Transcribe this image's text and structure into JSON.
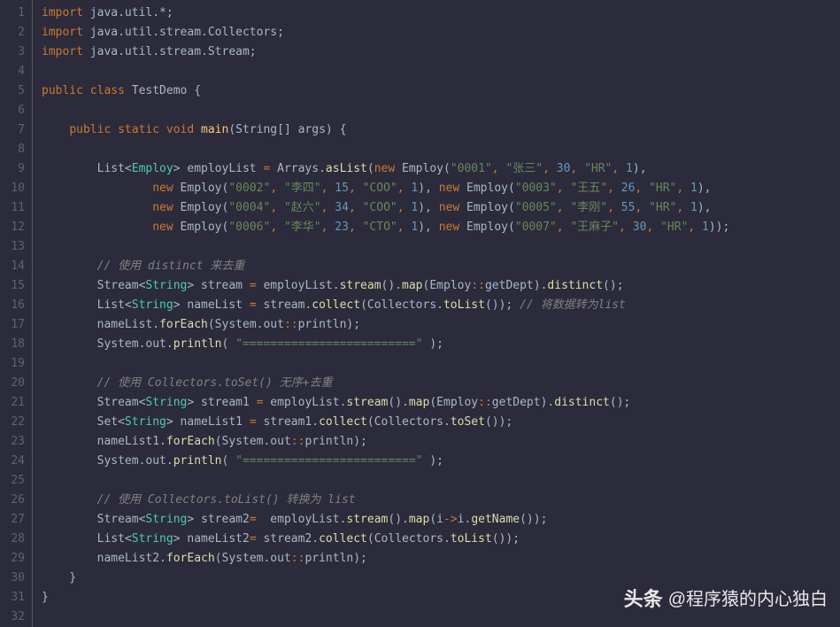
{
  "lines": [
    {
      "n": 1,
      "seg": [
        [
          "kw",
          "import"
        ],
        [
          "",
          ""
        ],
        [
          "punc",
          " java.util.*;"
        ]
      ]
    },
    {
      "n": 2,
      "seg": [
        [
          "kw",
          "import"
        ],
        [
          "punc",
          " java.util.stream.Collectors;"
        ]
      ]
    },
    {
      "n": 3,
      "seg": [
        [
          "kw",
          "import"
        ],
        [
          "punc",
          " java.util.stream.Stream;"
        ]
      ]
    },
    {
      "n": 4,
      "seg": [
        [
          "",
          ""
        ]
      ]
    },
    {
      "n": 5,
      "seg": [
        [
          "kw",
          "public class"
        ],
        [
          "punc",
          " TestDemo {"
        ]
      ]
    },
    {
      "n": 6,
      "seg": [
        [
          "",
          ""
        ]
      ]
    },
    {
      "n": 7,
      "seg": [
        [
          "",
          "    "
        ],
        [
          "kw",
          "public static void "
        ],
        [
          "fn",
          "main"
        ],
        [
          "punc",
          "(String[] args"
        ],
        [
          "paren",
          ")"
        ],
        [
          "punc",
          " {"
        ]
      ]
    },
    {
      "n": 8,
      "seg": [
        [
          "",
          ""
        ]
      ]
    },
    {
      "n": 9,
      "seg": [
        [
          "",
          "        List<"
        ],
        [
          "type",
          "Employ"
        ],
        [
          "punc",
          "> employList "
        ],
        [
          "op",
          "="
        ],
        [
          "punc",
          " Arrays."
        ],
        [
          "fn2",
          "asList"
        ],
        [
          "punc",
          "("
        ],
        [
          "kw",
          "new"
        ],
        [
          "punc",
          " Employ("
        ],
        [
          "str",
          "\"0001\""
        ],
        [
          "op",
          ", "
        ],
        [
          "str",
          "\"张三\""
        ],
        [
          "op",
          ", "
        ],
        [
          "num",
          "30"
        ],
        [
          "op",
          ", "
        ],
        [
          "str",
          "\"HR\""
        ],
        [
          "op",
          ", "
        ],
        [
          "num",
          "1"
        ],
        [
          "punc",
          "),"
        ]
      ]
    },
    {
      "n": 10,
      "seg": [
        [
          "",
          "                "
        ],
        [
          "kw",
          "new"
        ],
        [
          "punc",
          " Employ("
        ],
        [
          "str",
          "\"0002\""
        ],
        [
          "op",
          ", "
        ],
        [
          "str",
          "\"李四\""
        ],
        [
          "op",
          ", "
        ],
        [
          "num",
          "15"
        ],
        [
          "op",
          ", "
        ],
        [
          "str",
          "\"COO\""
        ],
        [
          "op",
          ", "
        ],
        [
          "num",
          "1"
        ],
        [
          "punc",
          "), "
        ],
        [
          "kw",
          "new"
        ],
        [
          "punc",
          " Employ("
        ],
        [
          "str",
          "\"0003\""
        ],
        [
          "op",
          ", "
        ],
        [
          "str",
          "\"王五\""
        ],
        [
          "op",
          ", "
        ],
        [
          "num",
          "26"
        ],
        [
          "op",
          ", "
        ],
        [
          "str",
          "\"HR\""
        ],
        [
          "op",
          ", "
        ],
        [
          "num",
          "1"
        ],
        [
          "punc",
          "),"
        ]
      ]
    },
    {
      "n": 11,
      "seg": [
        [
          "",
          "                "
        ],
        [
          "kw",
          "new"
        ],
        [
          "punc",
          " Employ("
        ],
        [
          "str",
          "\"0004\""
        ],
        [
          "op",
          ", "
        ],
        [
          "str",
          "\"赵六\""
        ],
        [
          "op",
          ", "
        ],
        [
          "num",
          "34"
        ],
        [
          "op",
          ", "
        ],
        [
          "str",
          "\"COO\""
        ],
        [
          "op",
          ", "
        ],
        [
          "num",
          "1"
        ],
        [
          "punc",
          "), "
        ],
        [
          "kw",
          "new"
        ],
        [
          "punc",
          " Employ("
        ],
        [
          "str",
          "\"0005\""
        ],
        [
          "op",
          ", "
        ],
        [
          "str",
          "\"李刚\""
        ],
        [
          "op",
          ", "
        ],
        [
          "num",
          "55"
        ],
        [
          "op",
          ", "
        ],
        [
          "str",
          "\"HR\""
        ],
        [
          "op",
          ", "
        ],
        [
          "num",
          "1"
        ],
        [
          "punc",
          "),"
        ]
      ]
    },
    {
      "n": 12,
      "seg": [
        [
          "",
          "                "
        ],
        [
          "kw",
          "new"
        ],
        [
          "punc",
          " Employ("
        ],
        [
          "str",
          "\"0006\""
        ],
        [
          "op",
          ", "
        ],
        [
          "str",
          "\"李华\""
        ],
        [
          "op",
          ", "
        ],
        [
          "num",
          "23"
        ],
        [
          "op",
          ", "
        ],
        [
          "str",
          "\"CTO\""
        ],
        [
          "op",
          ", "
        ],
        [
          "num",
          "1"
        ],
        [
          "punc",
          "), "
        ],
        [
          "kw",
          "new"
        ],
        [
          "punc",
          " Employ("
        ],
        [
          "str",
          "\"0007\""
        ],
        [
          "op",
          ", "
        ],
        [
          "str",
          "\"王麻子\""
        ],
        [
          "op",
          ", "
        ],
        [
          "num",
          "30"
        ],
        [
          "op",
          ", "
        ],
        [
          "str",
          "\"HR\""
        ],
        [
          "op",
          ", "
        ],
        [
          "num",
          "1"
        ],
        [
          "punc",
          "));"
        ]
      ]
    },
    {
      "n": 13,
      "seg": [
        [
          "",
          ""
        ]
      ]
    },
    {
      "n": 14,
      "seg": [
        [
          "",
          "        "
        ],
        [
          "cmt",
          "// 使用 distinct 来去重"
        ]
      ]
    },
    {
      "n": 15,
      "seg": [
        [
          "",
          "        Stream<"
        ],
        [
          "type",
          "String"
        ],
        [
          "punc",
          "> stream "
        ],
        [
          "op",
          "="
        ],
        [
          "punc",
          " employList."
        ],
        [
          "fn2",
          "stream"
        ],
        [
          "punc",
          "()."
        ],
        [
          "fn2",
          "map"
        ],
        [
          "punc",
          "(Employ"
        ],
        [
          "op",
          "::"
        ],
        [
          "punc",
          "getDept)."
        ],
        [
          "fn2",
          "distinct"
        ],
        [
          "punc",
          "();"
        ]
      ]
    },
    {
      "n": 16,
      "seg": [
        [
          "",
          "        List<"
        ],
        [
          "type",
          "String"
        ],
        [
          "punc",
          "> nameList "
        ],
        [
          "op",
          "="
        ],
        [
          "punc",
          " stream."
        ],
        [
          "fn2",
          "collect"
        ],
        [
          "punc",
          "(Collectors."
        ],
        [
          "fn2",
          "toList"
        ],
        [
          "punc",
          "()); "
        ],
        [
          "cmt",
          "// 将数据转为list"
        ]
      ]
    },
    {
      "n": 17,
      "seg": [
        [
          "",
          "        nameList."
        ],
        [
          "fn2",
          "forEach"
        ],
        [
          "punc",
          "(System.out"
        ],
        [
          "op",
          "::"
        ],
        [
          "punc",
          "println);"
        ]
      ]
    },
    {
      "n": 18,
      "seg": [
        [
          "",
          "        System.out."
        ],
        [
          "fn2",
          "println"
        ],
        [
          "punc",
          "( "
        ],
        [
          "str",
          "\"=========================\""
        ],
        [
          "punc",
          " );"
        ]
      ]
    },
    {
      "n": 19,
      "seg": [
        [
          "",
          ""
        ]
      ]
    },
    {
      "n": 20,
      "seg": [
        [
          "",
          "        "
        ],
        [
          "cmt",
          "// 使用 Collectors.toSet() 无序+去重"
        ]
      ]
    },
    {
      "n": 21,
      "seg": [
        [
          "",
          "        Stream<"
        ],
        [
          "type",
          "String"
        ],
        [
          "punc",
          "> stream1 "
        ],
        [
          "op",
          "="
        ],
        [
          "punc",
          " employList."
        ],
        [
          "fn2",
          "stream"
        ],
        [
          "punc",
          "()."
        ],
        [
          "fn2",
          "map"
        ],
        [
          "punc",
          "(Employ"
        ],
        [
          "op",
          "::"
        ],
        [
          "punc",
          "getDept)."
        ],
        [
          "fn2",
          "distinct"
        ],
        [
          "punc",
          "();"
        ]
      ]
    },
    {
      "n": 22,
      "seg": [
        [
          "",
          "        Set<"
        ],
        [
          "type",
          "String"
        ],
        [
          "punc",
          "> nameList1 "
        ],
        [
          "op",
          "="
        ],
        [
          "punc",
          " stream1."
        ],
        [
          "fn2",
          "collect"
        ],
        [
          "punc",
          "(Collectors."
        ],
        [
          "fn2",
          "toSet"
        ],
        [
          "punc",
          "());"
        ]
      ]
    },
    {
      "n": 23,
      "seg": [
        [
          "",
          "        nameList1."
        ],
        [
          "fn2",
          "forEach"
        ],
        [
          "punc",
          "(System.out"
        ],
        [
          "op",
          "::"
        ],
        [
          "punc",
          "println);"
        ]
      ]
    },
    {
      "n": 24,
      "seg": [
        [
          "",
          "        System.out."
        ],
        [
          "fn2",
          "println"
        ],
        [
          "punc",
          "( "
        ],
        [
          "str",
          "\"=========================\""
        ],
        [
          "punc",
          " );"
        ]
      ]
    },
    {
      "n": 25,
      "seg": [
        [
          "",
          ""
        ]
      ]
    },
    {
      "n": 26,
      "seg": [
        [
          "",
          "        "
        ],
        [
          "cmt",
          "// 使用 Collectors.toList() 转换为 list"
        ]
      ]
    },
    {
      "n": 27,
      "seg": [
        [
          "",
          "        Stream<"
        ],
        [
          "type",
          "String"
        ],
        [
          "punc",
          "> stream2"
        ],
        [
          "op",
          "="
        ],
        [
          "punc",
          "  employList."
        ],
        [
          "fn2",
          "stream"
        ],
        [
          "punc",
          "()."
        ],
        [
          "fn2",
          "map"
        ],
        [
          "punc",
          "(i"
        ],
        [
          "op",
          "->"
        ],
        [
          "punc",
          "i."
        ],
        [
          "fn2",
          "getName"
        ],
        [
          "punc",
          "());"
        ]
      ]
    },
    {
      "n": 28,
      "seg": [
        [
          "",
          "        List<"
        ],
        [
          "type",
          "String"
        ],
        [
          "punc",
          "> nameList2"
        ],
        [
          "op",
          "="
        ],
        [
          "punc",
          " stream2."
        ],
        [
          "fn2",
          "collect"
        ],
        [
          "punc",
          "(Collectors."
        ],
        [
          "fn2",
          "toList"
        ],
        [
          "punc",
          "());"
        ]
      ]
    },
    {
      "n": 29,
      "seg": [
        [
          "",
          "        nameList2."
        ],
        [
          "fn2",
          "forEach"
        ],
        [
          "punc",
          "(System.out"
        ],
        [
          "op",
          "::"
        ],
        [
          "punc",
          "println);"
        ]
      ]
    },
    {
      "n": 30,
      "seg": [
        [
          "",
          "    }"
        ]
      ]
    },
    {
      "n": 31,
      "seg": [
        [
          "",
          "}"
        ]
      ]
    },
    {
      "n": 32,
      "seg": [
        [
          "",
          ""
        ]
      ]
    }
  ],
  "watermark": {
    "logo": "头条",
    "handle": "@程序猿的内心独白"
  }
}
